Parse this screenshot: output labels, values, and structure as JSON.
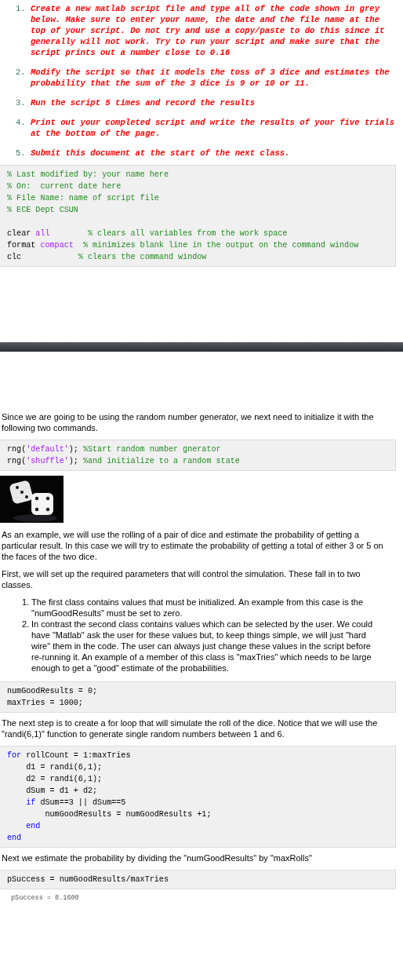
{
  "instructions": [
    {
      "number": "1.",
      "text": "Create a new matlab script file and type all of the code shown in grey below.  Make sure to enter your name, the date and the file name at the top of your script.  Do not try and use a copy/paste to do this since it generally will not work.  Try to run your script and make sure that the script prints out a number close to 0.16"
    },
    {
      "number": "2.",
      "text": "Modify the script so that it models the toss of 3 dice and estimates the probability that the sum of the 3 dice is 9 or 10 or 11."
    },
    {
      "number": "3.",
      "text": "Run the script 5 times and record the results"
    },
    {
      "number": "4.",
      "text": "Print out your completed script and write the results of your five trials at the bottom of the page."
    },
    {
      "number": "5.",
      "text": "Submit this document at the start of the next class."
    }
  ],
  "sections": [
    {
      "kind": "code",
      "groups": [
        [
          [
            {
              "kind": "comment",
              "text": "% Last modified by: your name here"
            }
          ],
          [
            {
              "kind": "comment",
              "text": "% On:  current date here"
            }
          ],
          [
            {
              "kind": "comment",
              "text": "% File Name: name of script file"
            }
          ],
          [
            {
              "kind": "comment",
              "text": "% ECE Dept CSUN"
            }
          ]
        ],
        [
          [
            {
              "kind": "plain",
              "text": "clear "
            },
            {
              "kind": "string",
              "text": "all"
            },
            {
              "kind": "comment",
              "text": "        % clears all variables from the work space"
            }
          ],
          [
            {
              "kind": "plain",
              "text": "format "
            },
            {
              "kind": "string",
              "text": "compact"
            },
            {
              "kind": "comment",
              "text": "  % minimizes blank line in the output on the command window"
            }
          ],
          [
            {
              "kind": "plain",
              "text": "clc            "
            },
            {
              "kind": "comment",
              "text": "% clears the command window"
            }
          ]
        ]
      ]
    },
    {
      "kind": "break"
    },
    {
      "kind": "paragraph",
      "text": "Since we are going to be using the random number generator, we next need to initialize it with the following two commands."
    },
    {
      "kind": "code",
      "groups": [
        [
          [
            {
              "kind": "plain",
              "text": "rng("
            },
            {
              "kind": "string",
              "text": "'default'"
            },
            {
              "kind": "plain",
              "text": "); "
            },
            {
              "kind": "comment",
              "text": "%Start random number gnerator"
            }
          ],
          [
            {
              "kind": "plain",
              "text": "rng("
            },
            {
              "kind": "string",
              "text": "'shuffle'"
            },
            {
              "kind": "plain",
              "text": "); "
            },
            {
              "kind": "comment",
              "text": "%and initialize to a random state"
            }
          ]
        ]
      ]
    },
    {
      "kind": "picture"
    },
    {
      "kind": "paragraph",
      "text": "As an example, we will use the rolling of a pair of dice and estimate the probability of getting a particular result.  In this case we will try to estimate the probability of getting a total of either 3 or 5 on the faces of the two dice."
    },
    {
      "kind": "paragraph",
      "text": "First, we will set up the required parameters that will control the simulation.  These fall in to two classes."
    },
    {
      "kind": "list",
      "items": [
        {
          "number": "1.",
          "text": "The first class contains values that must be initialized.  An example from this case is the \"numGoodResults\" must be set to zero."
        },
        {
          "number": "2.",
          "text": "In contrast the second class contains values which can be selected by the user.  We could have \"Matlab\" ask the user for these values but, to keep things simple, we will just \"hard wire\" them in the code.  The user can always just change these values in the script before re-running it.  An example of a member of this class is \"maxTries\" which needs to be large enough to get a \"good\" estimate of the probabilities."
        }
      ]
    },
    {
      "kind": "code",
      "groups": [
        [
          [
            {
              "kind": "plain",
              "text": "numGoodResults = 0;"
            }
          ],
          [
            {
              "kind": "plain",
              "text": "maxTries = 1000;"
            }
          ]
        ]
      ]
    },
    {
      "kind": "paragraph",
      "text": "The next step is to create a for loop that will simulate the roll of the dice.  Notice that we will use the \"randi(6,1)\" function to generate single random numbers between 1 and 6."
    },
    {
      "kind": "code",
      "groups": [
        [
          [
            {
              "kind": "keyword",
              "text": "for"
            },
            {
              "kind": "plain",
              "text": " rollCount = 1:maxTries"
            }
          ],
          [
            {
              "kind": "plain",
              "text": "    d1 = randi(6,1);"
            }
          ],
          [
            {
              "kind": "plain",
              "text": "    d2 = randi(6,1);"
            }
          ],
          [
            {
              "kind": "plain",
              "text": "    dSum = d1 + d2;"
            }
          ],
          [
            {
              "kind": "keyword",
              "text": "    if"
            },
            {
              "kind": "plain",
              "text": " dSum==3 || dSum==5"
            }
          ],
          [
            {
              "kind": "plain",
              "text": "        numGoodResults = numGoodResults +1;"
            }
          ],
          [
            {
              "kind": "keyword",
              "text": "    end"
            }
          ],
          [
            {
              "kind": "keyword",
              "text": "end"
            }
          ]
        ]
      ]
    },
    {
      "kind": "paragraph",
      "text": "Next we estimate the probability by dividing the \"numGoodResults\" by \"maxRolls\""
    },
    {
      "kind": "code",
      "groups": [
        [
          [
            {
              "kind": "plain",
              "text": "pSuccess = numGoodResults/maxTries"
            }
          ]
        ]
      ]
    },
    {
      "kind": "output",
      "text": "pSuccess = 0.1600"
    }
  ]
}
